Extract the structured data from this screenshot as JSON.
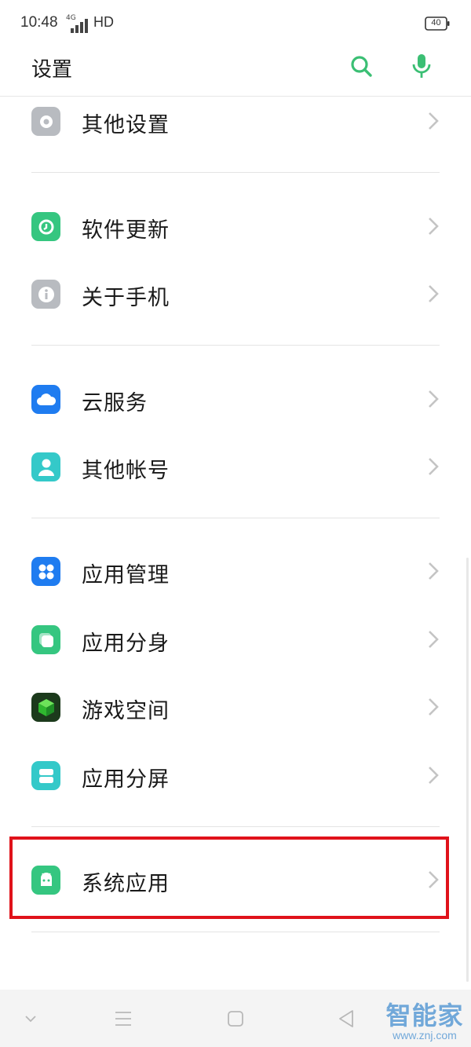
{
  "status_bar": {
    "time": "10:48",
    "network": "4G",
    "hd": "HD",
    "battery": "40"
  },
  "header": {
    "title": "设置",
    "search_icon": "search-icon",
    "mic_icon": "mic-icon"
  },
  "colors": {
    "accent": "#3bbf74",
    "highlight": "#e0121a"
  },
  "menu": {
    "other_settings": {
      "label": "其他设置",
      "icon": "gear-icon",
      "color": "#b8bbc0"
    },
    "software_update": {
      "label": "软件更新",
      "icon": "update-icon",
      "color": "#35c680"
    },
    "about_phone": {
      "label": "关于手机",
      "icon": "info-icon",
      "color": "#b8bbc0"
    },
    "cloud_service": {
      "label": "云服务",
      "icon": "cloud-icon",
      "color": "#1f7cf0"
    },
    "other_accounts": {
      "label": "其他帐号",
      "icon": "user-icon",
      "color": "#34c9c9"
    },
    "app_management": {
      "label": "应用管理",
      "icon": "apps-icon",
      "color": "#1f7cf0"
    },
    "app_clone": {
      "label": "应用分身",
      "icon": "clone-icon",
      "color": "#35c680"
    },
    "game_space": {
      "label": "游戏空间",
      "icon": "game-cube-icon",
      "color": "#1c3a1c"
    },
    "split_screen": {
      "label": "应用分屏",
      "icon": "split-screen-icon",
      "color": "#34c9c9"
    },
    "system_apps": {
      "label": "系统应用",
      "icon": "android-icon",
      "color": "#35c680"
    }
  },
  "watermark": {
    "brand": "智能家",
    "site": "www.znj.com"
  }
}
